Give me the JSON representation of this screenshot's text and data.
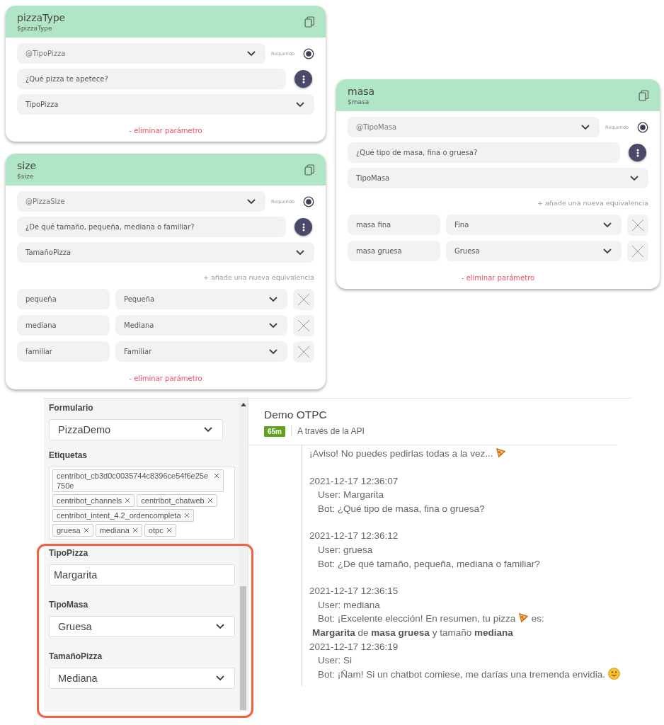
{
  "parameter_cards": [
    {
      "title": "pizzaType",
      "variable": "$pizzaType",
      "entity": "@TipoPizza",
      "required_label": "Requerido",
      "required": true,
      "prompt": "¿Qué pizza te apetece?",
      "entity_type": "TipoPizza",
      "remove_label": "- eliminar parámetro"
    },
    {
      "title": "size",
      "variable": "$size",
      "entity": "@PizzaSize",
      "required_label": "Requerido",
      "required": true,
      "prompt": "¿De qué tamaño, pequeña, mediana o familiar?",
      "entity_type": "TamañoPizza",
      "add_label": "+ añade una nueva equivalencia",
      "equivalences": [
        {
          "synonym": "pequeña",
          "value": "Pequeña"
        },
        {
          "synonym": "mediana",
          "value": "Mediana"
        },
        {
          "synonym": "familiar",
          "value": "Familiar"
        }
      ],
      "remove_label": "- eliminar parámetro"
    },
    {
      "title": "masa",
      "variable": "$masa",
      "entity": "@TipoMasa",
      "required_label": "Requerido",
      "required": true,
      "prompt": "¿Qué tipo de masa, fina o gruesa?",
      "entity_type": "TipoMasa",
      "add_label": "+ añade una nueva equivalencia",
      "equivalences": [
        {
          "synonym": "masa fina",
          "value": "Fina"
        },
        {
          "synonym": "masa gruesa",
          "value": "Gruesa"
        }
      ],
      "remove_label": "- eliminar parámetro"
    }
  ],
  "form_panel": {
    "form_label": "Formulario",
    "form_value": "PizzaDemo",
    "tags_label": "Etiquetas",
    "tags": [
      "centribot_cb3d0c0035744c8396ce54f6e25e750e",
      "centribot_channels",
      "centribot_chatweb",
      "centribot_intent_4.2_ordencompleta",
      "gruesa",
      "mediana",
      "otpc"
    ],
    "fields": [
      {
        "label": "TipoPizza",
        "kind": "text",
        "value": "Margarita"
      },
      {
        "label": "TipoMasa",
        "kind": "select",
        "value": "Gruesa"
      },
      {
        "label": "TamañoPizza",
        "kind": "select",
        "value": "Mediana"
      }
    ]
  },
  "chat": {
    "title": "Demo OTPC",
    "badge": "65m",
    "channel": "A través de la API",
    "groups": [
      {
        "lines": [
          {
            "kind": "notice",
            "text": "¡Aviso! No puedes pedirlas todas a la vez..."
          }
        ]
      },
      {
        "lines": [
          {
            "kind": "timestamp",
            "text": "2021-12-17 12:36:07"
          },
          {
            "kind": "message",
            "text": "User: Margarita"
          },
          {
            "kind": "message",
            "text": "Bot: ¿Qué tipo de masa, fina o gruesa?"
          }
        ]
      },
      {
        "lines": [
          {
            "kind": "timestamp",
            "text": "2021-12-17 12:36:12"
          },
          {
            "kind": "message",
            "text": "User: gruesa"
          },
          {
            "kind": "message",
            "text": "Bot: ¿De qué tamaño, pequeña, mediana o familiar?"
          }
        ]
      },
      {
        "lines": [
          {
            "kind": "timestamp",
            "text": "2021-12-17 12:36:15"
          },
          {
            "kind": "message",
            "text": "User: mediana"
          },
          {
            "kind": "pizzamessage",
            "text": "Bot: ¡Excelente elección! En resumen, tu pizza",
            "after": "es:"
          },
          {
            "kind": "summary",
            "text": "**Margarita** de **masa gruesa** y tamaño **mediana**"
          },
          {
            "kind": "timestamp",
            "text": "2021-12-17 12:36:19"
          },
          {
            "kind": "message",
            "text": "User: Si"
          },
          {
            "kind": "facemessage",
            "text": "Bot: ¡Ñam! Si un chatbot comiese, me darías una tremenda envidia."
          }
        ]
      }
    ]
  }
}
